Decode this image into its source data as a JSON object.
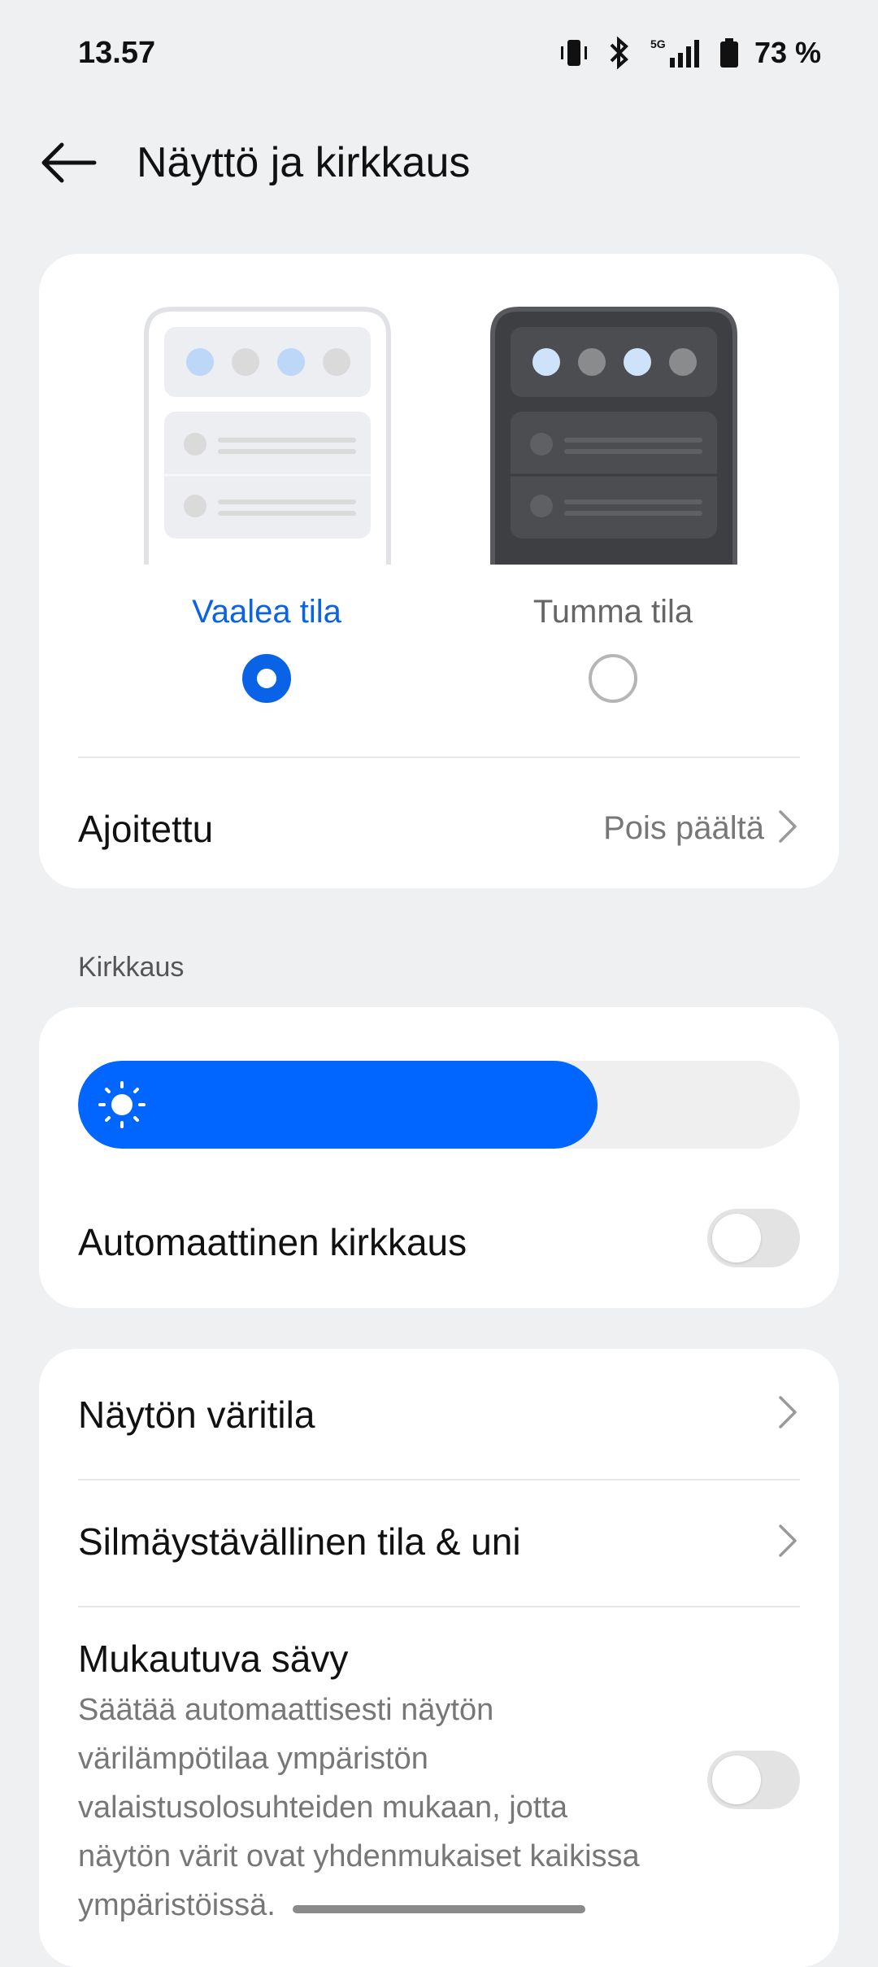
{
  "status_bar": {
    "time": "13.57",
    "battery": "73 %",
    "network": "5G"
  },
  "header": {
    "title": "Näyttö ja kirkkaus"
  },
  "theme": {
    "light_label": "Vaalea tila",
    "dark_label": "Tumma tila",
    "selected": "light",
    "scheduled_label": "Ajoitettu",
    "scheduled_value": "Pois päältä"
  },
  "brightness": {
    "section_label": "Kirkkaus",
    "level_percent": 72,
    "auto_label": "Automaattinen kirkkaus",
    "auto_enabled": false
  },
  "display": {
    "color_mode_label": "Näytön väritila",
    "eye_comfort_label": "Silmäystävällinen tila & uni",
    "adaptive_tone_label": "Mukautuva sävy",
    "adaptive_tone_desc": "Säätää automaattisesti näytön värilämpötilaa ympäristön valaistusolosuhteiden mukaan, jotta näytön värit ovat yhdenmukaiset kaikissa ympäristöissä.",
    "adaptive_tone_enabled": false
  },
  "colors": {
    "accent": "#0a63e6",
    "slider_fill": "#0066ff",
    "background": "#eff0f2"
  }
}
